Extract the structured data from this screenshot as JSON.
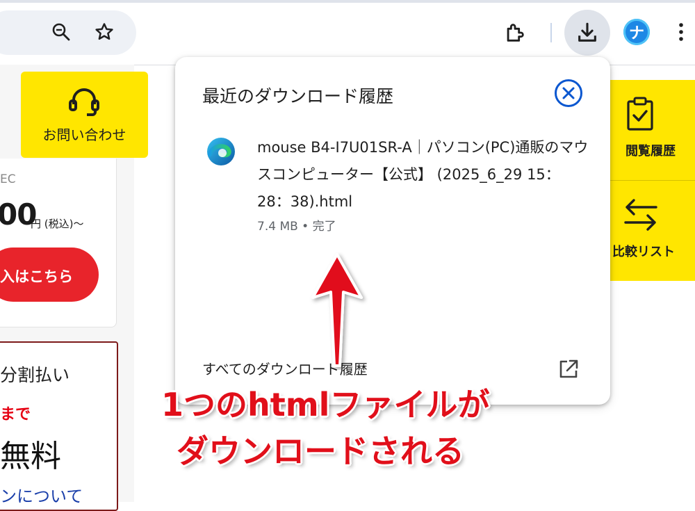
{
  "browser": {
    "toolbar_icons": [
      "zoom-icon",
      "bookmark-star-icon",
      "extensions-icon",
      "download-icon",
      "profile-avatar",
      "more-menu-icon"
    ],
    "profile_initial": "ナ",
    "colors": {
      "toolbar_bg": "#ffffff",
      "omnibox_bg": "#eef1f6",
      "download_active_bg": "#dfe3ea",
      "profile_bg": "#1e88e5"
    }
  },
  "page": {
    "contact_label": "お問い合わせ",
    "maker_fragment": "EC",
    "price_fragment": "00",
    "price_unit": "円 (税込)～",
    "buy_button_label": "入はこちら",
    "payment_title": "分割払い",
    "payment_sub": "まで",
    "payment_free": "無料",
    "payment_link": "ンについて",
    "history_label": "閲覧履歴",
    "compare_label": "比較リスト",
    "colors": {
      "accent_yellow": "#ffe600",
      "buy_red": "#e8242b",
      "link_blue": "#1a3faa"
    }
  },
  "download_bubble": {
    "title": "最近のダウンロード履歴",
    "item": {
      "icon": "edge-icon",
      "file_name": "mouse B4-I7U01SR-A｜パソコン(PC)通販のマウスコンピューター【公式】 (2025_6_29 15：28：38).html",
      "status": "7.4 MB • 完了"
    },
    "all_history_label": "すべてのダウンロード履歴"
  },
  "annotation": {
    "line1": "1つのhtmlファイルが",
    "line2": "ダウンロードされる",
    "color": "#e10f1a"
  }
}
